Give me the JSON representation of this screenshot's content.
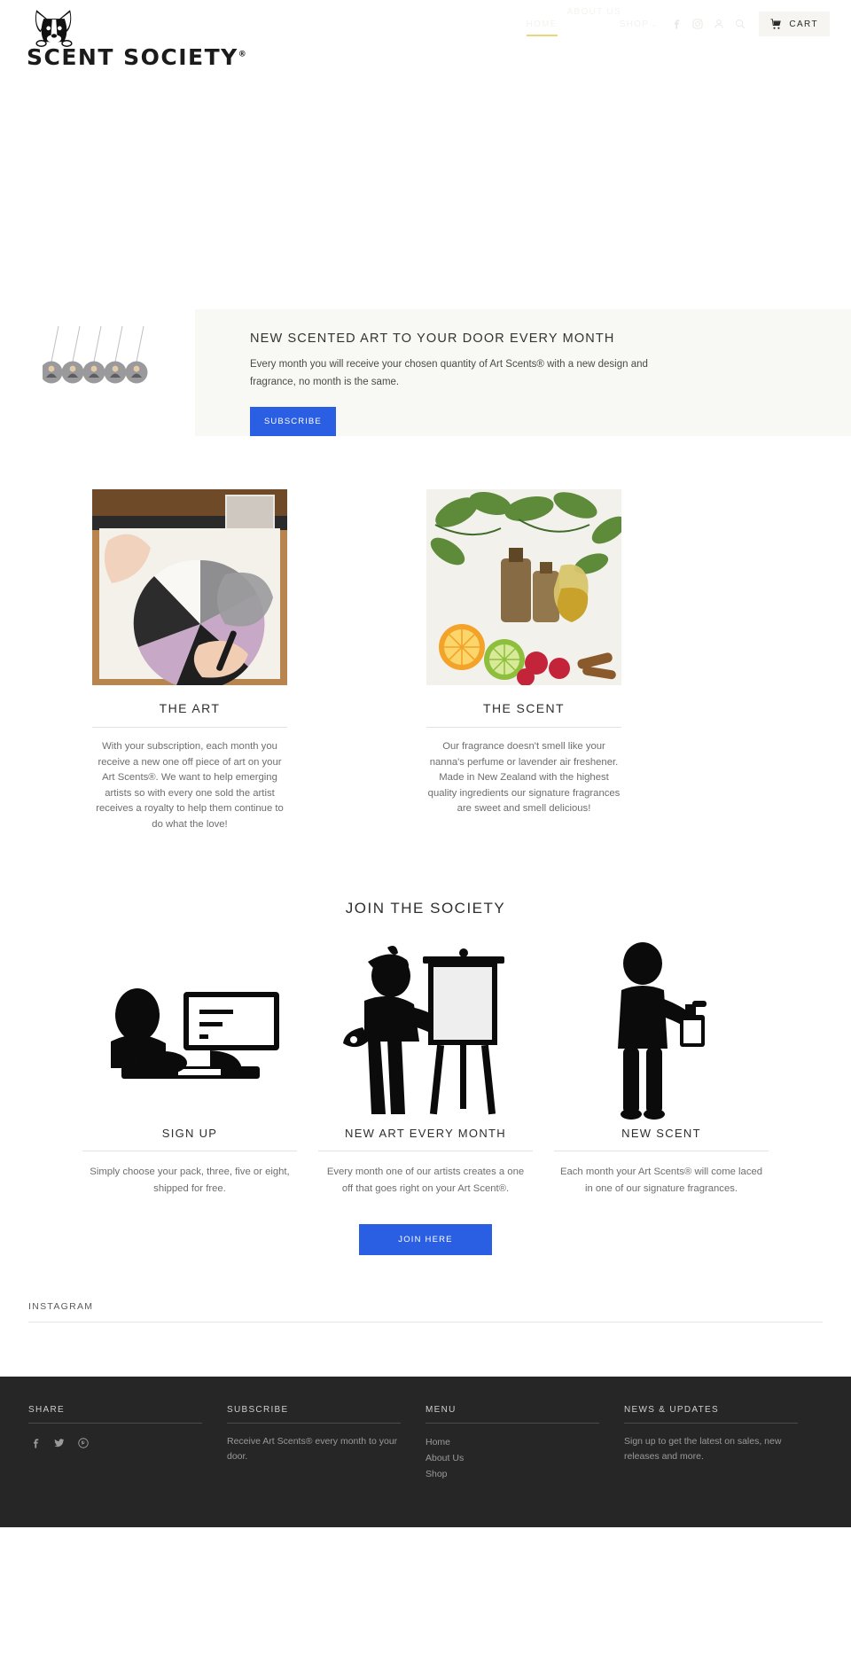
{
  "brand": {
    "name": "SCENT SOCIETY",
    "registered_mark": "®",
    "logo_icon": "french-bulldog-icon"
  },
  "nav": {
    "items": [
      {
        "label": "HOME",
        "active": true,
        "has_dropdown": false
      },
      {
        "label": "ABOUT US",
        "active": false,
        "has_dropdown": false
      },
      {
        "label": "SHOP",
        "active": false,
        "has_dropdown": true,
        "caret": "⌄"
      }
    ],
    "icons": [
      {
        "name": "facebook-icon",
        "label": "Facebook"
      },
      {
        "name": "instagram-icon",
        "label": "Instagram"
      },
      {
        "name": "account-icon",
        "label": "Account"
      },
      {
        "name": "search-icon",
        "label": "Search"
      }
    ],
    "cart": {
      "label": "CART",
      "icon": "shopping-cart-icon"
    },
    "active_underline_color": "#e8d77c"
  },
  "hero": {
    "title": "NEW SCENTED ART TO YOUR DOOR EVERY MONTH",
    "body": "Every month you will receive your chosen quantity of Art Scents® with a new design and fragrance, no month is the same.",
    "button_label": "SUBSCRIBE",
    "button_color": "#2b5fe3",
    "background_color": "#f8f8f4",
    "image_name": "air-freshener-hanging-tags-image"
  },
  "features": [
    {
      "title": "THE ART",
      "body": "With your subscription, each month you receive a new one off piece of art on your Art Scents®. We want to help emerging artists so with every one sold the artist receives a royalty to help them continue to do what the love!",
      "image_name": "artist-drawing-geometric-circle-image"
    },
    {
      "title": "THE SCENT",
      "body": "Our fragrance doesn't smell like your nanna's perfume or lavender air freshener. Made in New Zealand with the highest quality ingredients our signature fragrances are sweet and smell delicious!",
      "image_name": "essential-oils-citrus-berries-image"
    }
  ],
  "join": {
    "heading": "JOIN THE SOCIETY",
    "steps": [
      {
        "title": "SIGN UP",
        "body": "Simply choose your pack, three, five or eight, shipped for free.",
        "icon": "person-at-computer-icon"
      },
      {
        "title": "NEW ART EVERY MONTH",
        "body": "Every month one of our artists creates a one off that goes right on your Art Scent®.",
        "icon": "artist-at-easel-icon"
      },
      {
        "title": "NEW SCENT",
        "body": "Each month your Art Scents® will come laced in one of our signature fragrances.",
        "icon": "person-spraying-bottle-icon"
      }
    ],
    "cta_label": "JOIN HERE",
    "cta_color": "#2b5fe3"
  },
  "instagram": {
    "label": "INSTAGRAM"
  },
  "footer": {
    "background_color": "#262626",
    "columns": [
      {
        "title": "SHARE",
        "type": "social",
        "icons": [
          {
            "name": "facebook-icon",
            "label": "Facebook"
          },
          {
            "name": "twitter-icon",
            "label": "Twitter"
          },
          {
            "name": "pinterest-icon",
            "label": "Pinterest"
          }
        ]
      },
      {
        "title": "SUBSCRIBE",
        "type": "text",
        "text": "Receive Art Scents® every month to your door."
      },
      {
        "title": "MENU",
        "type": "links",
        "links": [
          "Home",
          "About Us",
          "Shop"
        ]
      },
      {
        "title": "NEWS & UPDATES",
        "type": "text",
        "text": "Sign up to get the latest on sales, new releases and more."
      }
    ]
  }
}
